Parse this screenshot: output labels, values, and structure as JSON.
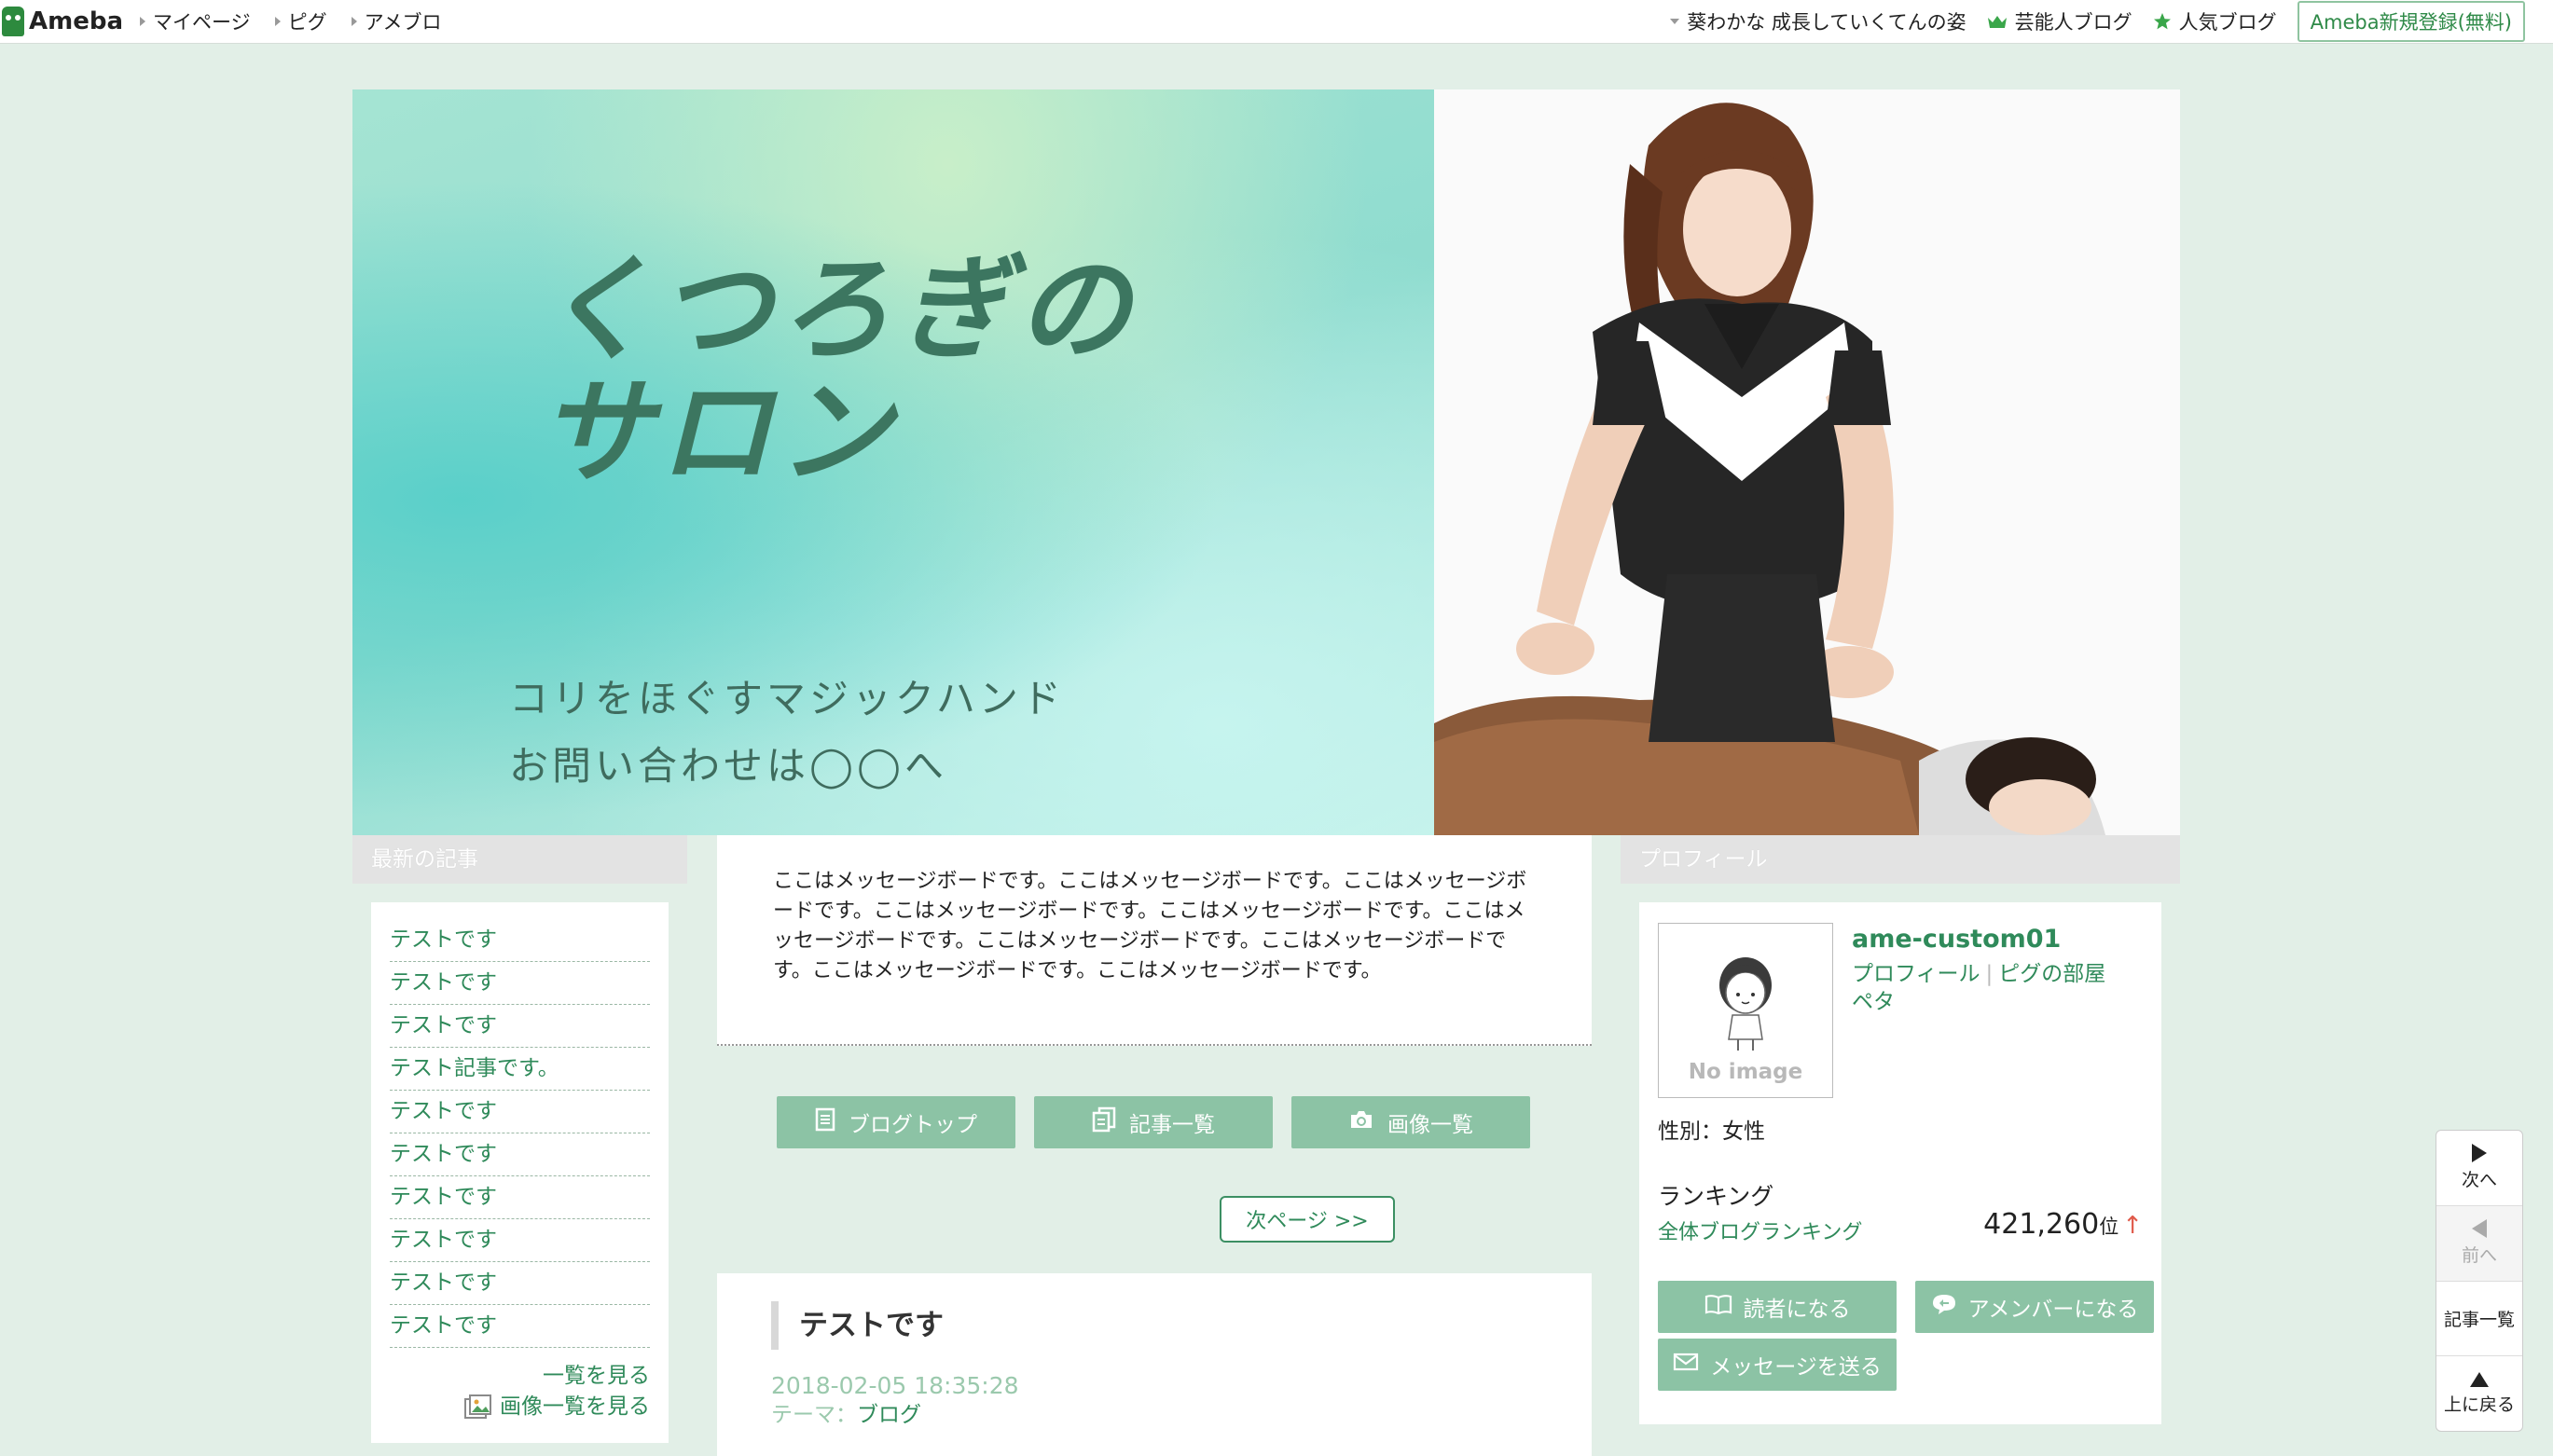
{
  "topbar": {
    "logo_text": "Ameba",
    "nav_left": [
      "マイページ",
      "ピグ",
      "アメブロ"
    ],
    "nav_right": {
      "ticker": "葵わかな 成長していくてんの姿",
      "celebrity_blog": "芸能人ブログ",
      "popular_blog": "人気ブログ",
      "register": "Ameba新規登録(無料)"
    }
  },
  "banner": {
    "title_line1": "くつろぎの",
    "title_line2": "サロン",
    "sub_line1": "コリをほぐすマジックハンド",
    "sub_line2": "お問い合わせは◯◯へ"
  },
  "sidebar_left": {
    "heading": "最新の記事",
    "articles": [
      "テストです",
      "テストです",
      "テストです",
      "テスト記事です。",
      "テストです",
      "テストです",
      "テストです",
      "テストです",
      "テストです",
      "テストです"
    ],
    "see_all": "一覧を見る",
    "see_images": "画像一覧を見る"
  },
  "main": {
    "message_board": "ここはメッセージボードです。ここはメッセージボードです。ここはメッセージボードです。ここはメッセージボードです。ここはメッセージボードです。ここはメッセージボードです。ここはメッセージボードです。ここはメッセージボードです。ここはメッセージボードです。ここはメッセージボードです。",
    "buttons": {
      "blog_top": "ブログトップ",
      "article_list": "記事一覧",
      "image_list": "画像一覧"
    },
    "next_page": "次ページ >>",
    "post": {
      "title": "テストです",
      "date": "2018-02-05 18:35:28",
      "theme_label": "テーマ：",
      "theme_value": "ブログ"
    }
  },
  "profile": {
    "heading": "プロフィール",
    "no_image": "No image",
    "username": "ame-custom01",
    "link_profile": "プロフィール",
    "link_pig_room": "ピグの部屋",
    "link_peta": "ペタ",
    "gender": "性別：女性",
    "ranking_heading": "ランキング",
    "ranking_link": "全体ブログランキング",
    "ranking_value": "421,260",
    "ranking_unit": "位",
    "ranking_arrow": "↑",
    "btn_reader": "読者になる",
    "btn_amember": "アメンバーになる",
    "btn_message": "メッセージを送る"
  },
  "float_nav": {
    "next": "次へ",
    "prev": "前へ",
    "article_list": "記事一覧",
    "back_top": "上に戻る"
  },
  "colors": {
    "page_bg": "#e2efe7",
    "accent_green": "#2f8a5a",
    "button_green": "#8cc3a5",
    "rank_up": "#e05a4a"
  }
}
